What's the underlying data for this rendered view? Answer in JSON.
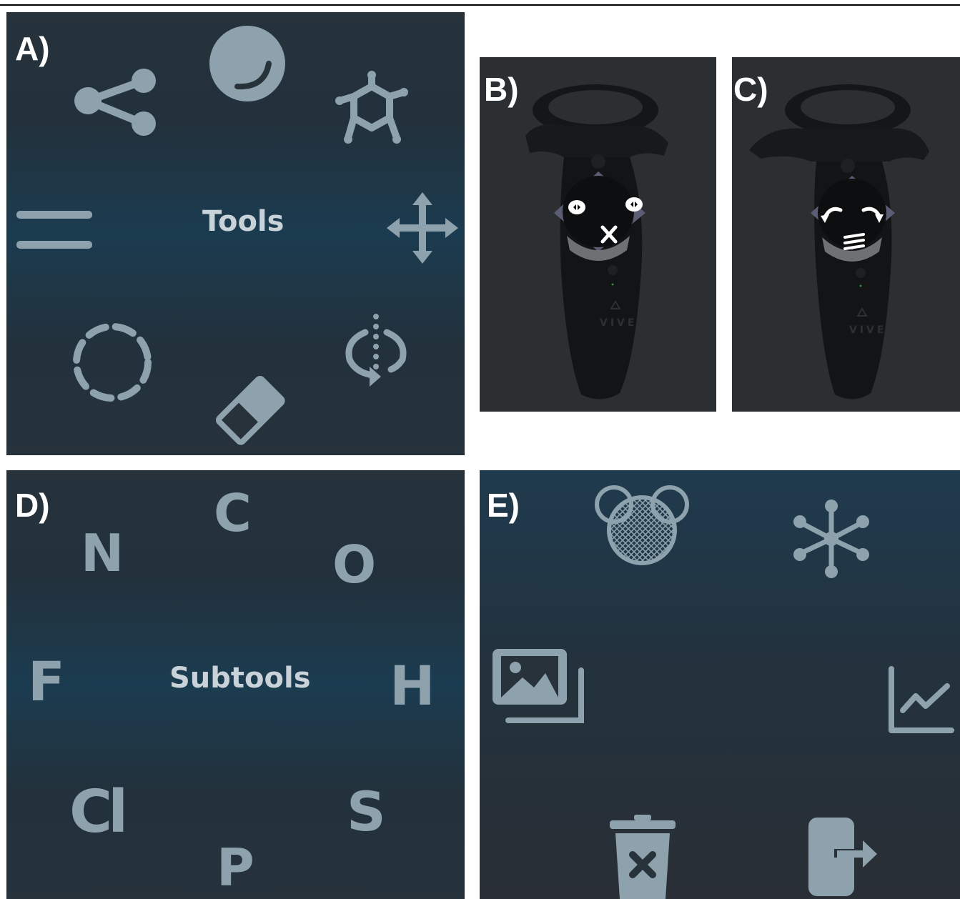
{
  "panels": {
    "a": {
      "label": "A)",
      "center_text": "Tools",
      "icons": [
        "sphere-icon",
        "share-icon",
        "molecule-ring-icon",
        "menu-icon",
        "move-arrows-icon",
        "dashed-circle-icon",
        "rotate-icon",
        "eraser-icon"
      ]
    },
    "b": {
      "label": "B)",
      "controller_text": "VIVE",
      "icons": [
        "left-arrow-icon",
        "right-arrow-icon",
        "tools-icon"
      ]
    },
    "c": {
      "label": "C)",
      "controller_text": "VIVE",
      "icons": [
        "undo-icon",
        "redo-icon",
        "menu-icon"
      ]
    },
    "d": {
      "label": "D)",
      "center_text": "Subtools",
      "elements": {
        "c": "C",
        "n": "N",
        "o": "O",
        "f": "F",
        "h": "H",
        "cl": "Cl",
        "s": "S",
        "p": "P"
      }
    },
    "e": {
      "label": "E)",
      "icons": [
        "mesh-surface-icon",
        "molecule-spokes-icon",
        "image-gallery-icon",
        "line-chart-icon",
        "delete-icon",
        "exit-icon"
      ]
    }
  },
  "colors": {
    "icon": "#8ea2ad",
    "label": "#ffffff",
    "center_text": "#c9d2d8",
    "panel_dark": "#27323b",
    "panel_band": "#1b3c50"
  }
}
